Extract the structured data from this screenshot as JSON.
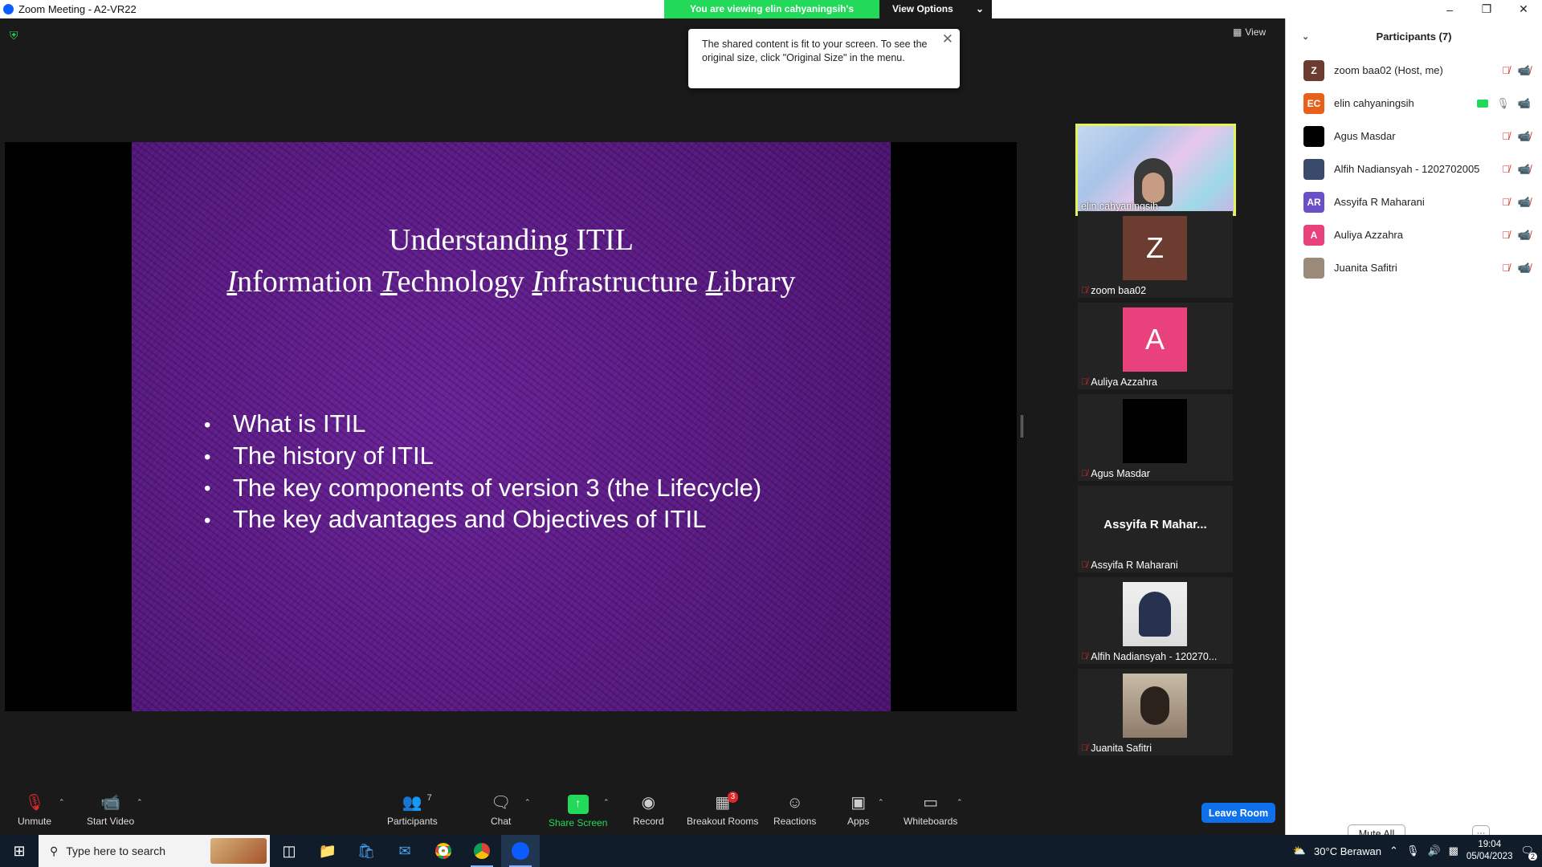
{
  "window": {
    "title": "Zoom Meeting - A2-VR22"
  },
  "banner": {
    "message": "You are viewing elin cahyaningsih's screen",
    "options_label": "View Options"
  },
  "stage": {
    "view_label": "View"
  },
  "tooltip": {
    "text": "The shared content is fit to your screen. To see the original size, click \"Original Size\" in the menu."
  },
  "slide": {
    "title": "Understanding ITIL",
    "subtitle_parts": [
      {
        "first": "I",
        "rest": "nformation "
      },
      {
        "first": "T",
        "rest": "echnology "
      },
      {
        "first": "I",
        "rest": "nfrastructure "
      },
      {
        "first": "L",
        "rest": "ibrary"
      }
    ],
    "bullets": [
      "What is ITIL",
      "The history of ITIL",
      "The key components of version 3 (the Lifecycle)",
      "The key advantages and Objectives of ITIL"
    ]
  },
  "tiles": {
    "elin": "elin cahyaningsih",
    "zoom": {
      "name": "zoom baa02",
      "initial": "Z",
      "color": "#6b3c2f"
    },
    "auliya": {
      "name": "Auliya Azzahra",
      "initial": "A",
      "color": "#e8417b"
    },
    "agus": {
      "name": "Agus Masdar"
    },
    "assyifa": {
      "name": "Assyifa R Maharani",
      "display": "Assyifa R Mahar..."
    },
    "alfih": {
      "name": "Alfih Nadiansyah - 120270..."
    },
    "juanita": {
      "name": "Juanita Safitri"
    }
  },
  "toolbar": {
    "unmute": "Unmute",
    "start_video": "Start Video",
    "participants": "Participants",
    "participants_count": "7",
    "chat": "Chat",
    "share_screen": "Share Screen",
    "record": "Record",
    "breakout_rooms": "Breakout Rooms",
    "breakout_badge": "3",
    "reactions": "Reactions",
    "apps": "Apps",
    "whiteboards": "Whiteboards",
    "leave": "Leave Room"
  },
  "panel": {
    "title": "Participants (7)",
    "participants": [
      {
        "name": "zoom baa02 (Host, me)",
        "avatar": "Z",
        "color": "#6b3c2f"
      },
      {
        "name": "elin cahyaningsih",
        "avatar": "EC",
        "color": "#e8601c"
      },
      {
        "name": "Agus Masdar",
        "avatar": "",
        "color": "#000000"
      },
      {
        "name": "Alfih Nadiansyah - 1202702005",
        "avatar": "",
        "color": "#3a4a6a"
      },
      {
        "name": "Assyifa R Maharani",
        "avatar": "AR",
        "color": "#6a4fc8"
      },
      {
        "name": "Auliya Azzahra",
        "avatar": "A",
        "color": "#e8417b"
      },
      {
        "name": "Juanita Safitri",
        "avatar": "",
        "color": "#9b8a7a"
      }
    ],
    "mute_all": "Mute All",
    "more": "···"
  },
  "taskbar": {
    "search_placeholder": "Type here to search",
    "weather": "30°C Berawan",
    "time": "19:04",
    "date": "05/04/2023",
    "notifications": "2"
  },
  "colors": {
    "accent": "#0e71eb",
    "green": "#23d959",
    "slide_bg": "#5b1a85",
    "active_speaker": "#e5f35a"
  }
}
